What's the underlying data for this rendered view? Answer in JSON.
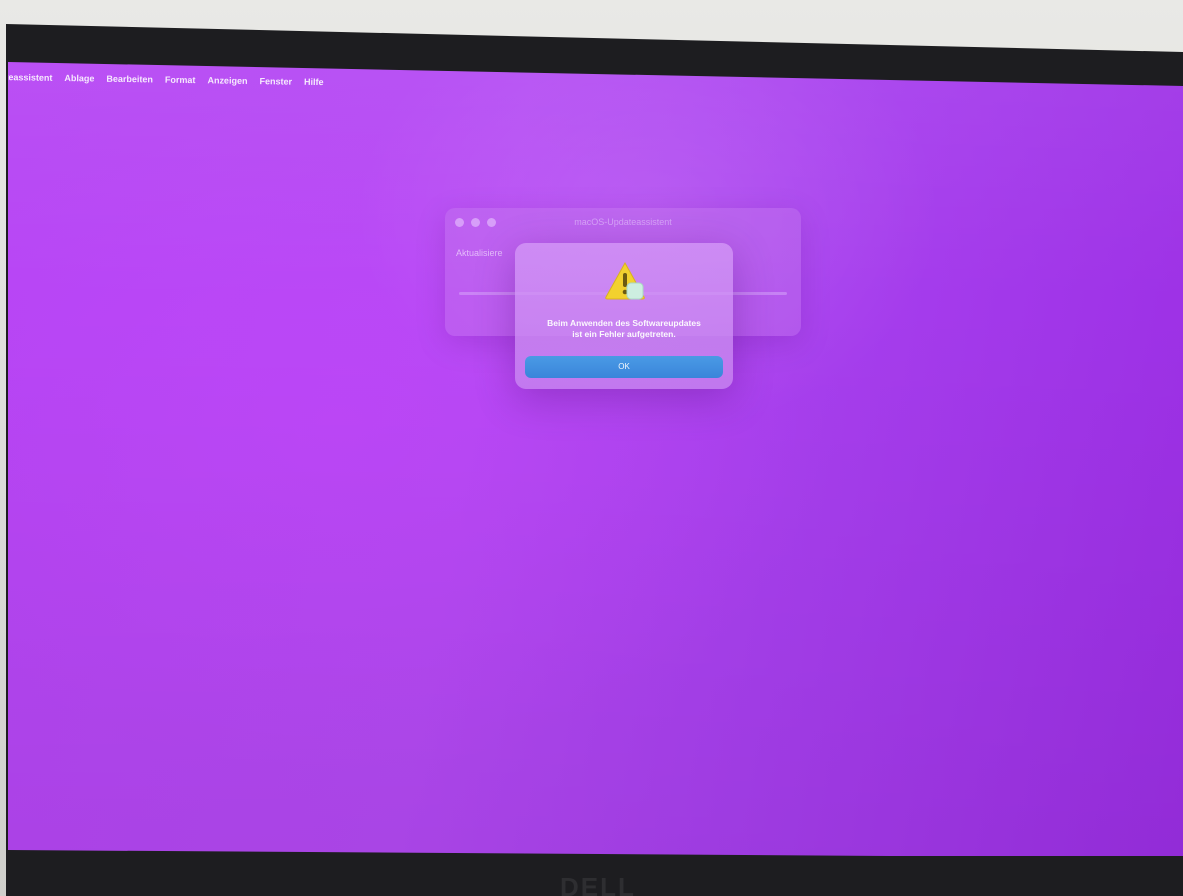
{
  "menubar": {
    "items": [
      "lateassistent",
      "Ablage",
      "Bearbeiten",
      "Format",
      "Anzeigen",
      "Fenster",
      "Hilfe"
    ]
  },
  "background_window": {
    "title": "macOS-Updateassistent",
    "label": "Aktualisiere"
  },
  "alert": {
    "icon": "warning-triangle-icon",
    "message_line1": "Beim Anwenden des Softwareupdates",
    "message_line2": "ist ein Fehler aufgetreten.",
    "ok_label": "OK",
    "ok_color": "#3a86dc"
  },
  "colors": {
    "desktop": "#b047f2",
    "bezel": "#1d1d20"
  },
  "monitor": {
    "brand": "DELL"
  }
}
